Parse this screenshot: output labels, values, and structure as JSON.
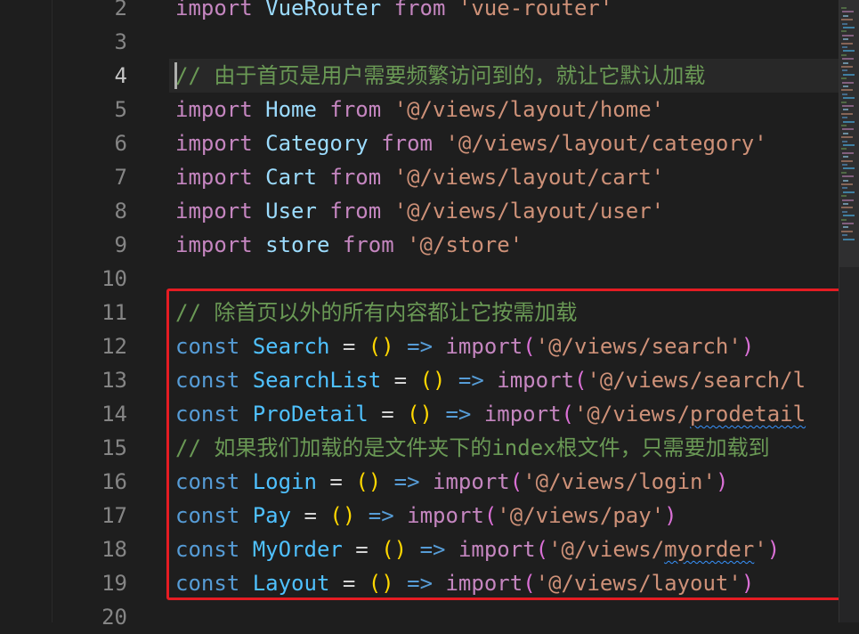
{
  "editor": {
    "active_line": "4",
    "lines": [
      {
        "number": "2",
        "tokens": [
          {
            "t": "import",
            "c": "kw"
          },
          {
            "t": " ",
            "c": "op"
          },
          {
            "t": "VueRouter",
            "c": "id"
          },
          {
            "t": " ",
            "c": "op"
          },
          {
            "t": "from",
            "c": "kw"
          },
          {
            "t": " ",
            "c": "op"
          },
          {
            "t": "'vue-router'",
            "c": "str"
          }
        ]
      },
      {
        "number": "3",
        "tokens": []
      },
      {
        "number": "4",
        "tokens": [
          {
            "t": "// 由于首页是用户需要频繁访问到的，就让它默认加载",
            "c": "cm"
          }
        ]
      },
      {
        "number": "5",
        "tokens": [
          {
            "t": "import",
            "c": "kw"
          },
          {
            "t": " ",
            "c": "op"
          },
          {
            "t": "Home",
            "c": "id"
          },
          {
            "t": " ",
            "c": "op"
          },
          {
            "t": "from",
            "c": "kw"
          },
          {
            "t": " ",
            "c": "op"
          },
          {
            "t": "'@/views/layout/home'",
            "c": "str"
          }
        ]
      },
      {
        "number": "6",
        "tokens": [
          {
            "t": "import",
            "c": "kw"
          },
          {
            "t": " ",
            "c": "op"
          },
          {
            "t": "Category",
            "c": "id"
          },
          {
            "t": " ",
            "c": "op"
          },
          {
            "t": "from",
            "c": "kw"
          },
          {
            "t": " ",
            "c": "op"
          },
          {
            "t": "'@/views/layout/category'",
            "c": "str"
          }
        ]
      },
      {
        "number": "7",
        "tokens": [
          {
            "t": "import",
            "c": "kw"
          },
          {
            "t": " ",
            "c": "op"
          },
          {
            "t": "Cart",
            "c": "id"
          },
          {
            "t": " ",
            "c": "op"
          },
          {
            "t": "from",
            "c": "kw"
          },
          {
            "t": " ",
            "c": "op"
          },
          {
            "t": "'@/views/layout/cart'",
            "c": "str"
          }
        ]
      },
      {
        "number": "8",
        "tokens": [
          {
            "t": "import",
            "c": "kw"
          },
          {
            "t": " ",
            "c": "op"
          },
          {
            "t": "User",
            "c": "id"
          },
          {
            "t": " ",
            "c": "op"
          },
          {
            "t": "from",
            "c": "kw"
          },
          {
            "t": " ",
            "c": "op"
          },
          {
            "t": "'@/views/layout/user'",
            "c": "str"
          }
        ]
      },
      {
        "number": "9",
        "tokens": [
          {
            "t": "import",
            "c": "kw"
          },
          {
            "t": " ",
            "c": "op"
          },
          {
            "t": "store",
            "c": "id"
          },
          {
            "t": " ",
            "c": "op"
          },
          {
            "t": "from",
            "c": "kw"
          },
          {
            "t": " ",
            "c": "op"
          },
          {
            "t": "'@/store'",
            "c": "str"
          }
        ]
      },
      {
        "number": "10",
        "tokens": []
      },
      {
        "number": "11",
        "tokens": [
          {
            "t": "// 除首页以外的所有内容都让它按需加载",
            "c": "cm"
          }
        ]
      },
      {
        "number": "12",
        "tokens": [
          {
            "t": "const",
            "c": "kw2"
          },
          {
            "t": " ",
            "c": "op"
          },
          {
            "t": "Search",
            "c": "var"
          },
          {
            "t": " = ",
            "c": "op"
          },
          {
            "t": "()",
            "c": "paren"
          },
          {
            "t": " ",
            "c": "op"
          },
          {
            "t": "=>",
            "c": "arrow"
          },
          {
            "t": " ",
            "c": "op"
          },
          {
            "t": "import",
            "c": "fn"
          },
          {
            "t": "(",
            "c": "paren2"
          },
          {
            "t": "'@/views/search'",
            "c": "str"
          },
          {
            "t": ")",
            "c": "paren2"
          }
        ]
      },
      {
        "number": "13",
        "tokens": [
          {
            "t": "const",
            "c": "kw2"
          },
          {
            "t": " ",
            "c": "op"
          },
          {
            "t": "SearchList",
            "c": "var"
          },
          {
            "t": " = ",
            "c": "op"
          },
          {
            "t": "()",
            "c": "paren"
          },
          {
            "t": " ",
            "c": "op"
          },
          {
            "t": "=>",
            "c": "arrow"
          },
          {
            "t": " ",
            "c": "op"
          },
          {
            "t": "import",
            "c": "fn"
          },
          {
            "t": "(",
            "c": "paren2"
          },
          {
            "t": "'@/views/search/l",
            "c": "str"
          }
        ]
      },
      {
        "number": "14",
        "tokens": [
          {
            "t": "const",
            "c": "kw2"
          },
          {
            "t": " ",
            "c": "op"
          },
          {
            "t": "ProDetail",
            "c": "var"
          },
          {
            "t": " = ",
            "c": "op"
          },
          {
            "t": "()",
            "c": "paren"
          },
          {
            "t": " ",
            "c": "op"
          },
          {
            "t": "=>",
            "c": "arrow"
          },
          {
            "t": " ",
            "c": "op"
          },
          {
            "t": "import",
            "c": "fn"
          },
          {
            "t": "(",
            "c": "paren2"
          },
          {
            "t": "'@/views/",
            "c": "str"
          },
          {
            "t": "prodetail",
            "c": "str squig"
          }
        ]
      },
      {
        "number": "15",
        "tokens": [
          {
            "t": "// 如果我们加载的是文件夹下的index根文件，只需要加载到",
            "c": "cm"
          }
        ]
      },
      {
        "number": "16",
        "tokens": [
          {
            "t": "const",
            "c": "kw2"
          },
          {
            "t": " ",
            "c": "op"
          },
          {
            "t": "Login",
            "c": "var"
          },
          {
            "t": " = ",
            "c": "op"
          },
          {
            "t": "()",
            "c": "paren"
          },
          {
            "t": " ",
            "c": "op"
          },
          {
            "t": "=>",
            "c": "arrow"
          },
          {
            "t": " ",
            "c": "op"
          },
          {
            "t": "import",
            "c": "fn"
          },
          {
            "t": "(",
            "c": "paren2"
          },
          {
            "t": "'@/views/login'",
            "c": "str"
          },
          {
            "t": ")",
            "c": "paren2"
          }
        ]
      },
      {
        "number": "17",
        "tokens": [
          {
            "t": "const",
            "c": "kw2"
          },
          {
            "t": " ",
            "c": "op"
          },
          {
            "t": "Pay",
            "c": "var"
          },
          {
            "t": " = ",
            "c": "op"
          },
          {
            "t": "()",
            "c": "paren"
          },
          {
            "t": " ",
            "c": "op"
          },
          {
            "t": "=>",
            "c": "arrow"
          },
          {
            "t": " ",
            "c": "op"
          },
          {
            "t": "import",
            "c": "fn"
          },
          {
            "t": "(",
            "c": "paren2"
          },
          {
            "t": "'@/views/pay'",
            "c": "str"
          },
          {
            "t": ")",
            "c": "paren2"
          }
        ]
      },
      {
        "number": "18",
        "tokens": [
          {
            "t": "const",
            "c": "kw2"
          },
          {
            "t": " ",
            "c": "op"
          },
          {
            "t": "MyOrder",
            "c": "var"
          },
          {
            "t": " = ",
            "c": "op"
          },
          {
            "t": "()",
            "c": "paren"
          },
          {
            "t": " ",
            "c": "op"
          },
          {
            "t": "=>",
            "c": "arrow"
          },
          {
            "t": " ",
            "c": "op"
          },
          {
            "t": "import",
            "c": "fn"
          },
          {
            "t": "(",
            "c": "paren2"
          },
          {
            "t": "'@/views/",
            "c": "str"
          },
          {
            "t": "myorder",
            "c": "str squig"
          },
          {
            "t": "'",
            "c": "str"
          },
          {
            "t": ")",
            "c": "paren2"
          }
        ]
      },
      {
        "number": "19",
        "tokens": [
          {
            "t": "const",
            "c": "kw2"
          },
          {
            "t": " ",
            "c": "op"
          },
          {
            "t": "Layout",
            "c": "var"
          },
          {
            "t": " = ",
            "c": "op"
          },
          {
            "t": "()",
            "c": "paren"
          },
          {
            "t": " ",
            "c": "op"
          },
          {
            "t": "=>",
            "c": "arrow"
          },
          {
            "t": " ",
            "c": "op"
          },
          {
            "t": "import",
            "c": "fn"
          },
          {
            "t": "(",
            "c": "paren2"
          },
          {
            "t": "'@/views/layout'",
            "c": "str"
          },
          {
            "t": ")",
            "c": "paren2"
          }
        ]
      },
      {
        "number": "20",
        "tokens": []
      }
    ]
  },
  "colors": {
    "background": "#1e1e1e",
    "annotation_box": "#e51c23",
    "keyword": "#c586c0",
    "const_keyword": "#569cd6",
    "identifier": "#9cdcfe",
    "string": "#ce9178",
    "comment": "#6a9955",
    "bracket": "#ffd700"
  }
}
